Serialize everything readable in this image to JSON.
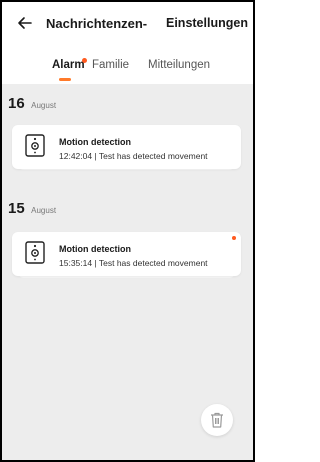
{
  "header": {
    "back_icon": "arrow-left-icon",
    "title": "Nachrichtenzen-",
    "settings_label": "Einstellungen"
  },
  "tabs": [
    {
      "label": "Alarm",
      "active": true,
      "has_badge": true
    },
    {
      "label": "Familie",
      "active": false,
      "has_badge": false
    },
    {
      "label": "Mitteilungen",
      "active": false,
      "has_badge": false
    }
  ],
  "colors": {
    "accent": "#ff7a2a",
    "badge": "#ff5a1f",
    "background": "#ededed"
  },
  "groups": [
    {
      "day": "16",
      "month": "August",
      "items": [
        {
          "title": "Motion detection",
          "subtitle": "12:42:04 | Test has detected movement",
          "icon": "camera-icon",
          "unread": false
        }
      ]
    },
    {
      "day": "15",
      "month": "August",
      "items": [
        {
          "title": "Motion detection",
          "subtitle": "15:35:14 | Test has detected movement",
          "icon": "camera-icon",
          "unread": true
        }
      ]
    }
  ],
  "actions": {
    "delete_icon": "trash-icon"
  }
}
